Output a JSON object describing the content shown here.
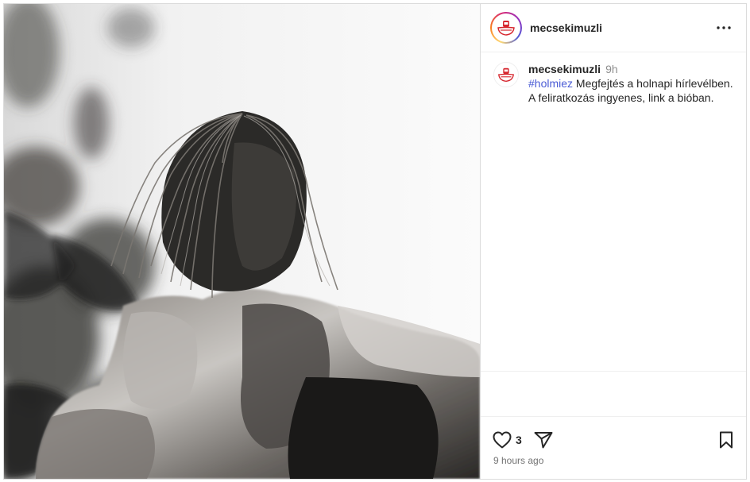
{
  "post": {
    "username": "mecsekimuzli",
    "more_icon": "more-horizontal-icon",
    "caption": {
      "username": "mecsekimuzli",
      "time": "9h",
      "hashtag": "#holmiez",
      "text": " Megfejtés a holnapi hírlevélben. A feliratkozás ingyenes, link a bióban."
    },
    "likes": "3",
    "time_ago": "9 hours ago",
    "icons": {
      "like": "heart-icon",
      "share": "send-icon",
      "save": "bookmark-icon"
    },
    "colors": {
      "hashtag": "#4a5bd5",
      "muted": "#737373",
      "border": "#dbdbdb"
    }
  }
}
